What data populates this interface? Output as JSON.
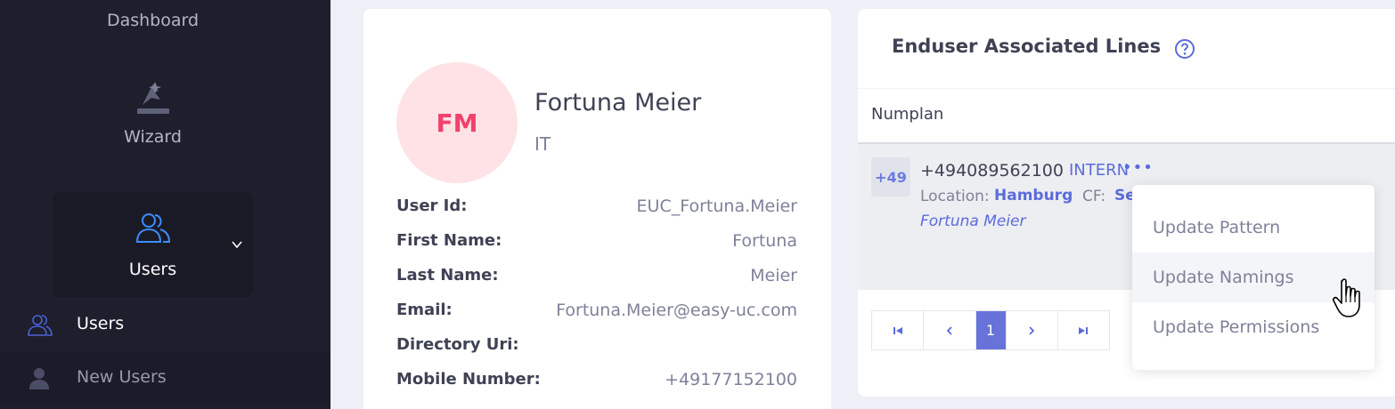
{
  "sidebar": {
    "dashboard_label": "Dashboard",
    "wizard_label": "Wizard",
    "users_group_label": "Users",
    "sub_items": [
      {
        "label": "Users",
        "icon": "users-icon"
      },
      {
        "label": "New Users",
        "icon": "user-icon"
      }
    ]
  },
  "profile": {
    "initials": "FM",
    "name": "Fortuna Meier",
    "department": "IT",
    "fields": [
      {
        "label": "User Id:",
        "value": "EUC_Fortuna.Meier"
      },
      {
        "label": "First Name:",
        "value": "Fortuna"
      },
      {
        "label": "Last Name:",
        "value": "Meier"
      },
      {
        "label": "Email:",
        "value": "Fortuna.Meier@easy-uc.com"
      },
      {
        "label": "Directory Uri:",
        "value": ""
      },
      {
        "label": "Mobile Number:",
        "value": "+49177152100"
      }
    ]
  },
  "lines": {
    "title": "Enduser Associated Lines",
    "column_header": "Numplan",
    "rows": [
      {
        "prefix": "+49",
        "number": "+494089562100",
        "type": "INTERN",
        "more": "•••",
        "location_label": "Location:",
        "location": "Hamburg",
        "cf_label": "CF:",
        "cf_value": "Se",
        "owner": "Fortuna Meier"
      }
    ],
    "pagination": {
      "current_page": "1"
    }
  },
  "context_menu": {
    "items": [
      "Update Pattern",
      "Update Namings",
      "Update Permissions"
    ]
  },
  "colors": {
    "sidebar_bg": "#1e1e2d",
    "accent": "#5b6cdb",
    "avatar_bg": "#ffe2e5",
    "avatar_text": "#f1416c"
  }
}
